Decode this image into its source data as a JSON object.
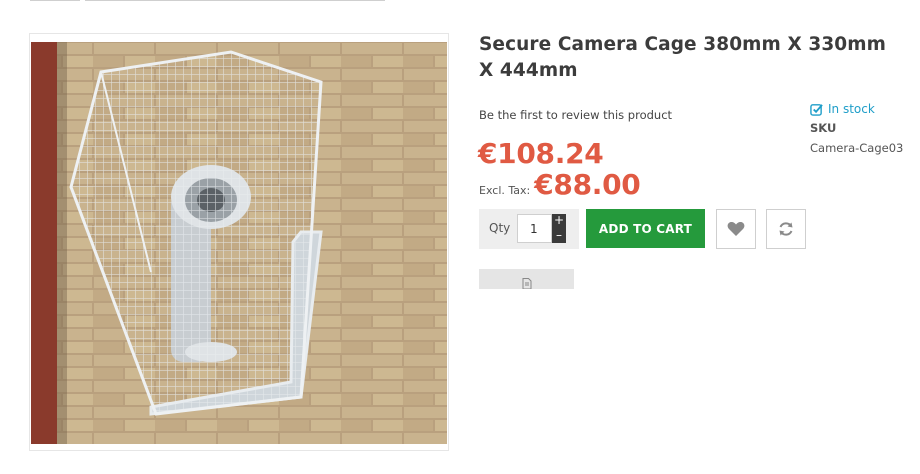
{
  "colors": {
    "price": "#e05a43",
    "stock": "#1f9ec9",
    "add_to_cart_bg": "#259a3c"
  },
  "product": {
    "title": "Secure Camera Cage 380mm X 330mm X 444mm",
    "image_alt": "Camera inside wire mesh security cage mounted on brick wall",
    "review_link": "Be the first to review this product",
    "stock_status": "In stock",
    "sku_label": "SKU",
    "sku_value": "Camera-Cage03",
    "price": "€108.24",
    "excl_tax_label": "Excl. Tax:",
    "excl_tax_price": "€88.00"
  },
  "cart": {
    "qty_label": "Qty",
    "qty_value": "1",
    "plus": "+",
    "minus": "–",
    "add_to_cart": "ADD TO CART"
  },
  "icons": {
    "stock": "check-square-icon",
    "wishlist": "heart-icon",
    "compare": "refresh-icon",
    "extra": "document-icon"
  }
}
